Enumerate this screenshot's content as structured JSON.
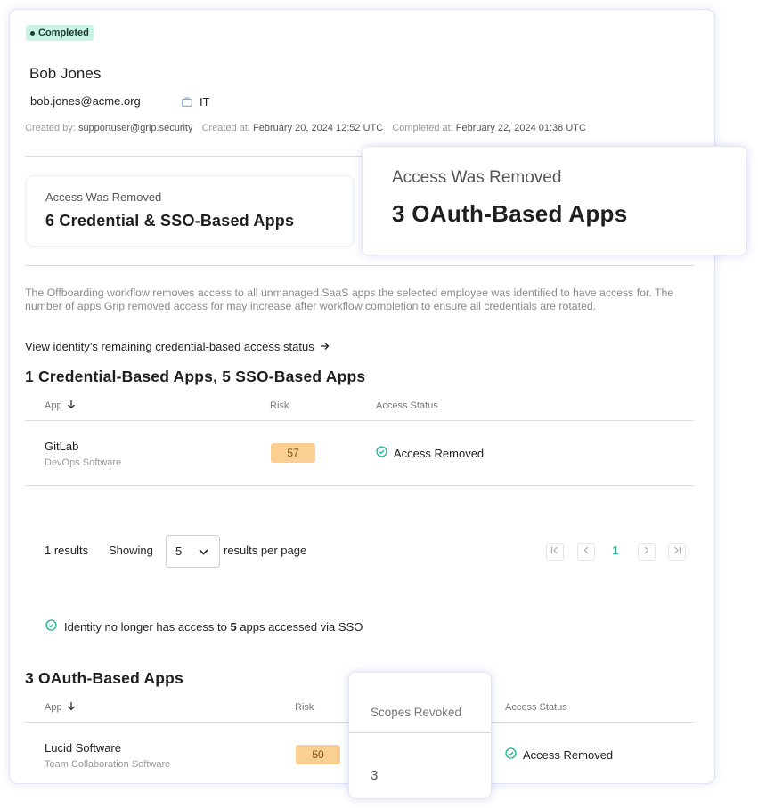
{
  "status_badge": "Completed",
  "employee": {
    "name": "Bob Jones",
    "email": "bob.jones@acme.org",
    "department": "IT"
  },
  "meta": {
    "created_by_label": "Created by:",
    "created_by": "supportuser@grip.security",
    "created_at_label": "Created at:",
    "created_at": "February 20, 2024 12:52 UTC",
    "completed_at_label": "Completed at:",
    "completed_at": "February 22, 2024 01:38 UTC"
  },
  "summary_cards": {
    "credential": {
      "label": "Access Was Removed",
      "value": "6 Credential & SSO-Based Apps"
    },
    "oauth": {
      "label": "Access Was Removed",
      "value": "3 OAuth-Based Apps"
    }
  },
  "description": "The Offboarding workflow removes access to all unmanaged SaaS apps the selected employee was identified to have access for. The number of apps Grip removed access for may increase after workflow completion to ensure all credentials are rotated.",
  "remaining_link": "View identity’s remaining credential-based access status",
  "credential_section": {
    "title": "1 Credential-Based Apps, 5 SSO-Based Apps",
    "columns": {
      "app": "App",
      "risk": "Risk",
      "access_status": "Access Status"
    },
    "rows": [
      {
        "name": "GitLab",
        "category": "DevOps Software",
        "risk": "57",
        "status": "Access Removed"
      }
    ],
    "pagination": {
      "results": "1 results",
      "showing": "Showing",
      "per_page_value": "5",
      "per_page_label": "results per page",
      "current_page": "1"
    },
    "sso_note": {
      "prefix": "Identity no longer has access to",
      "count": "5",
      "suffix": "apps accessed via SSO"
    }
  },
  "oauth_section": {
    "title": "3 OAuth-Based Apps",
    "columns": {
      "app": "App",
      "risk": "Risk",
      "scopes": "Scopes Revoked",
      "access_status": "Access Status"
    },
    "rows": [
      {
        "name": "Lucid Software",
        "category": "Team Collaboration Software",
        "risk": "50",
        "scopes": "3",
        "status": "Access Removed"
      }
    ]
  },
  "colors": {
    "accent_green": "#17b890",
    "risk_orange": "#fbcf91",
    "badge_bg": "#c9f3e4",
    "card_border": "#dfe3f3"
  },
  "icons": [
    "briefcase-icon",
    "arrow-right-icon",
    "arrow-down-icon",
    "check-circle-icon",
    "chevron-down-icon",
    "first-page-icon",
    "prev-page-icon",
    "next-page-icon",
    "last-page-icon"
  ]
}
